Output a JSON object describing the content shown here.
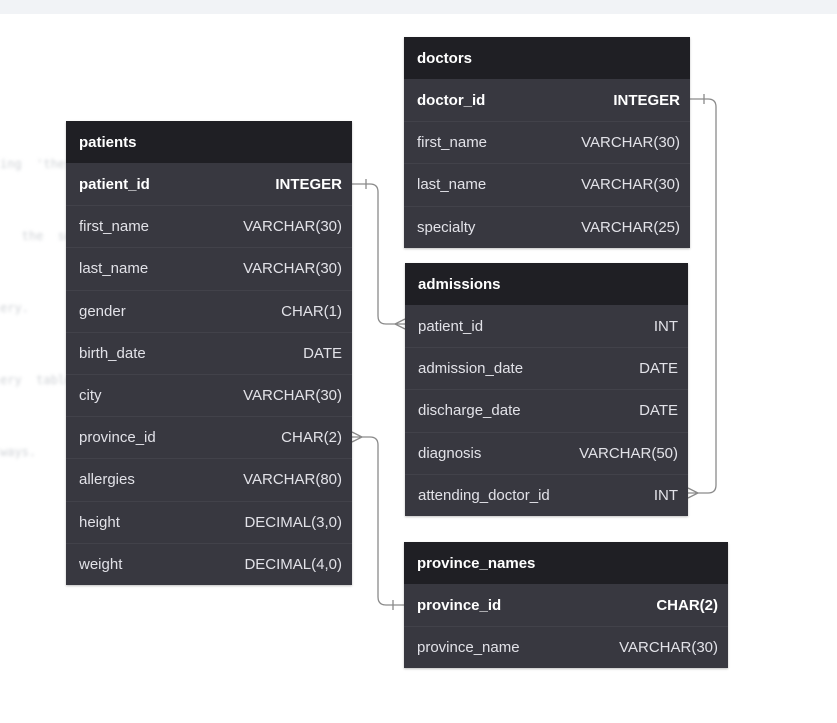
{
  "background_text": [
    "ing  'thesis  or  item  of  marketer'",
    "   the  second  item  of  the  total  is",
    "ery.",
    "ery  table",
    "ways."
  ],
  "tables": {
    "doctors": {
      "name": "doctors",
      "columns": [
        {
          "name": "doctor_id",
          "type": "INTEGER",
          "pk": true
        },
        {
          "name": "first_name",
          "type": "VARCHAR(30)"
        },
        {
          "name": "last_name",
          "type": "VARCHAR(30)"
        },
        {
          "name": "specialty",
          "type": "VARCHAR(25)"
        }
      ]
    },
    "patients": {
      "name": "patients",
      "columns": [
        {
          "name": "patient_id",
          "type": "INTEGER",
          "pk": true
        },
        {
          "name": "first_name",
          "type": "VARCHAR(30)"
        },
        {
          "name": "last_name",
          "type": "VARCHAR(30)"
        },
        {
          "name": "gender",
          "type": "CHAR(1)"
        },
        {
          "name": "birth_date",
          "type": "DATE"
        },
        {
          "name": "city",
          "type": "VARCHAR(30)"
        },
        {
          "name": "province_id",
          "type": "CHAR(2)"
        },
        {
          "name": "allergies",
          "type": "VARCHAR(80)"
        },
        {
          "name": "height",
          "type": "DECIMAL(3,0)"
        },
        {
          "name": "weight",
          "type": "DECIMAL(4,0)"
        }
      ]
    },
    "admissions": {
      "name": "admissions",
      "columns": [
        {
          "name": "patient_id",
          "type": "INT"
        },
        {
          "name": "admission_date",
          "type": "DATE"
        },
        {
          "name": "discharge_date",
          "type": "DATE"
        },
        {
          "name": "diagnosis",
          "type": "VARCHAR(50)"
        },
        {
          "name": "attending_doctor_id",
          "type": "INT"
        }
      ]
    },
    "province_names": {
      "name": "province_names",
      "columns": [
        {
          "name": "province_id",
          "type": "CHAR(2)",
          "pk": true
        },
        {
          "name": "province_name",
          "type": "VARCHAR(30)"
        }
      ]
    }
  },
  "colors": {
    "header_bg": "#1f1f24",
    "body_bg": "#383840",
    "text": "#e2e2e8",
    "connector": "#8a8a8a"
  }
}
